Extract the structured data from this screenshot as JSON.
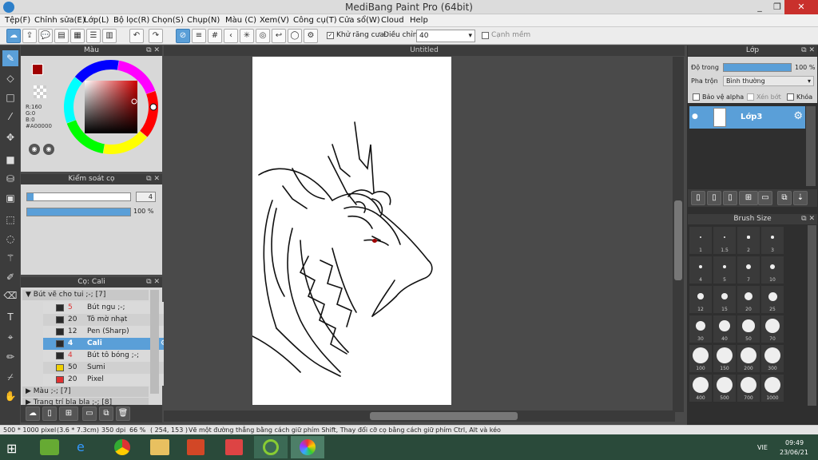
{
  "window": {
    "title": "MediBang Paint Pro (64bit)",
    "min": "_",
    "max": "❐",
    "close": "✕"
  },
  "menu": [
    "Tệp(F)",
    "Chỉnh sửa(E)",
    "Lớp(L)",
    "Bộ lọc(R)",
    "Chọn(S)",
    "Chụp(N)",
    "Màu (C)",
    "Xem(V)",
    "Công cụ(T)",
    "Cửa sổ(W)",
    "Cloud",
    "Help"
  ],
  "toolbar": {
    "antialias_label": "Khử răng cưa",
    "adjust_label": "Điều chỉnh",
    "adjust_value": "40",
    "canh_mem_label": "Cạnh mềm"
  },
  "color_panel": {
    "title": "Màu",
    "r": "R:160",
    "g": "G:0",
    "b": "B:0",
    "hex": "#A00000",
    "main_color": "#a00000"
  },
  "brush_control": {
    "title": "Kiểm soát cọ",
    "size": "4",
    "opacity": "100 %"
  },
  "brush_panel": {
    "title": "Cọ: Cali",
    "group1": "Bút vẽ cho tui ;-; [7]",
    "brushes": [
      {
        "size": "5",
        "name": "Bút ngu ;-;",
        "color": "#2a2a2a",
        "sel": false
      },
      {
        "size": "20",
        "name": "Tô mờ nhạt",
        "color": "#2a2a2a",
        "sel": false
      },
      {
        "size": "12",
        "name": "Pen (Sharp)",
        "color": "#2a2a2a",
        "sel": false
      },
      {
        "size": "4",
        "name": "Cali",
        "color": "#2a2a2a",
        "sel": true
      },
      {
        "size": "4",
        "name": "Bút tô bóng ;-;",
        "color": "#2a2a2a",
        "sel": false
      },
      {
        "size": "50",
        "name": "Sumi",
        "color": "#f0d000",
        "sel": false
      },
      {
        "size": "20",
        "name": "Pixel",
        "color": "#e03030",
        "sel": false
      }
    ],
    "group2": "Màu ;-; [7]",
    "group3": "Trang trí bla bla ;-; [8]"
  },
  "canvas": {
    "tab": "Untitled"
  },
  "layer_panel": {
    "title": "Lớp",
    "opacity_label": "Độ trong",
    "opacity_value": "100 %",
    "blend_label": "Pha trộn",
    "blend_value": "Bình thường",
    "protect_alpha": "Bảo vệ alpha",
    "clip": "Xén bớt",
    "lock": "Khóa",
    "layer_name": "Lớp3"
  },
  "brush_size_panel": {
    "title": "Brush Size",
    "sizes": [
      "1",
      "1.5",
      "2",
      "3",
      "4",
      "5",
      "7",
      "10",
      "12",
      "15",
      "20",
      "25",
      "30",
      "40",
      "50",
      "70",
      "100",
      "150",
      "200",
      "300",
      "400",
      "500",
      "700",
      "1000"
    ]
  },
  "status": {
    "dims": "500 * 1000 pixel",
    "cm": "(3.6 * 7.3cm)",
    "dpi": "350 dpi",
    "zoom": "66 %",
    "coords": "( 254, 153 )",
    "hint": "Vẽ một đường thẳng bằng cách giữ phím Shift, Thay đổi cỡ cọ bằng cách giữ phím Ctrl, Alt và kéo"
  },
  "taskbar": {
    "lang": "VIE",
    "time": "09:49",
    "date": "23/06/21"
  }
}
